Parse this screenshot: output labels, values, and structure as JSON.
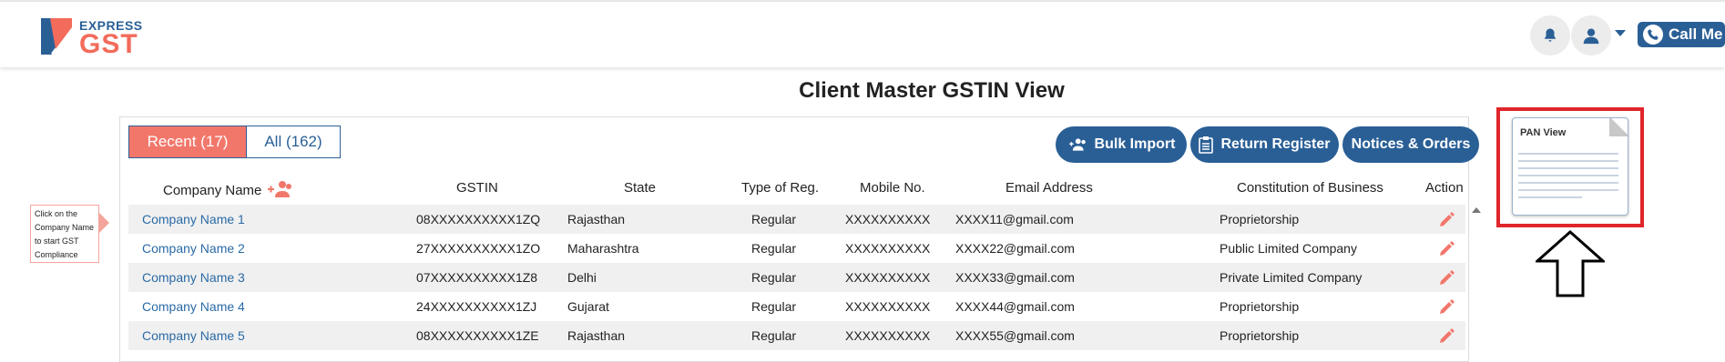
{
  "header": {
    "logo_top": "EXPRESS",
    "logo_bottom": "GST",
    "call_me": "Call Me",
    "icons": [
      "bell-icon",
      "user-icon",
      "chevron-down-icon",
      "phone-icon"
    ]
  },
  "page": {
    "title": "Client Master GSTIN View"
  },
  "tabs": {
    "recent": "Recent (17)",
    "all": "All (162)"
  },
  "actions": {
    "bulk_import": "Bulk Import",
    "return_register": "Return Register",
    "notices_orders": "Notices & Orders"
  },
  "table": {
    "headers": {
      "company": "Company Name",
      "gstin": "GSTIN",
      "state": "State",
      "type": "Type of Reg.",
      "mobile": "Mobile No.",
      "email": "Email Address",
      "constitution": "Constitution of Business",
      "action": "Action"
    },
    "rows": [
      {
        "company": "Company Name 1",
        "gstin": "08XXXXXXXXXX1ZQ",
        "state": "Rajasthan",
        "type": "Regular",
        "mobile": "XXXXXXXXXX",
        "email": "XXXX11@gmail.com",
        "constitution": "Proprietorship"
      },
      {
        "company": "Company Name 2",
        "gstin": "27XXXXXXXXXX1ZO",
        "state": "Maharashtra",
        "type": "Regular",
        "mobile": "XXXXXXXXXX",
        "email": "XXXX22@gmail.com",
        "constitution": "Public Limited Company"
      },
      {
        "company": "Company Name 3",
        "gstin": "07XXXXXXXXXX1Z8",
        "state": "Delhi",
        "type": "Regular",
        "mobile": "XXXXXXXXXX",
        "email": "XXXX33@gmail.com",
        "constitution": "Private Limited Company"
      },
      {
        "company": "Company Name 4",
        "gstin": "24XXXXXXXXXX1ZJ",
        "state": "Gujarat",
        "type": "Regular",
        "mobile": "XXXXXXXXXX",
        "email": "XXXX44@gmail.com",
        "constitution": "Proprietorship"
      },
      {
        "company": "Company Name 5",
        "gstin": "08XXXXXXXXXX1ZE",
        "state": "Rajasthan",
        "type": "Regular",
        "mobile": "XXXXXXXXXX",
        "email": "XXXX55@gmail.com",
        "constitution": "Proprietorship"
      }
    ]
  },
  "tooltip": {
    "lines": [
      "Click on the",
      "Company Name",
      "to start GST",
      "Compliance"
    ]
  },
  "pan_view": {
    "label": "PAN View"
  },
  "colors": {
    "brand_blue": "#2a5f96",
    "accent_coral": "#f2776b",
    "link_blue": "#2a6aa6",
    "highlight_red": "#e0262b"
  }
}
